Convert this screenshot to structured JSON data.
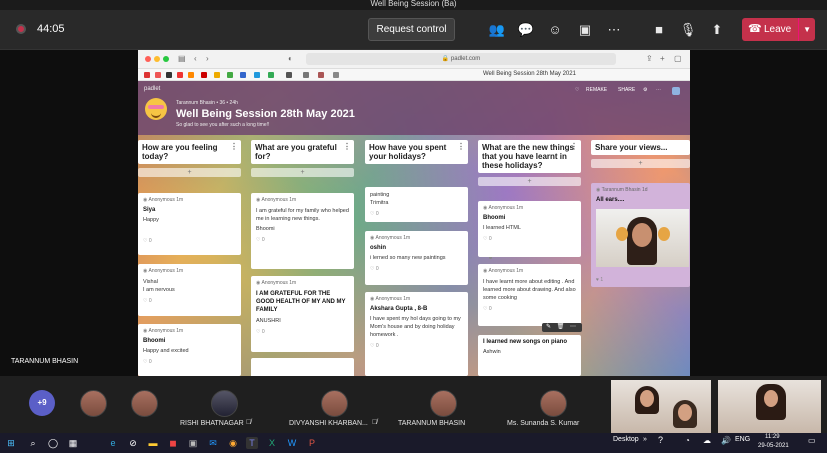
{
  "window": {
    "title": "Well Being Session (Ba)"
  },
  "meeting": {
    "timer": "44:05",
    "request_control": "Request control",
    "leave": "Leave",
    "icons": [
      "people-icon",
      "chat-icon",
      "reactions-icon",
      "rooms-icon",
      "more-icon",
      "camera-icon",
      "mic-icon",
      "share-icon"
    ],
    "accent": "#c4314b"
  },
  "presenter": {
    "name": "TARANNUM BHASIN"
  },
  "browser": {
    "url": "padlet.com",
    "tab_title": "Well Being Session 28th May 2021"
  },
  "padlet": {
    "brand": "padlet",
    "author": "Tarannum Bhasin",
    "author_meta": "• 36 • 24h",
    "title": "Well Being Session 28th May 2021",
    "subtitle": "So glad to see you after such a long time!!",
    "actions": {
      "remake": "REMAKE",
      "share": "SHARE"
    },
    "columns": [
      {
        "title": "How are you feeling today?"
      },
      {
        "title": "What are you grateful for?"
      },
      {
        "title": "How have you spent your holidays?"
      },
      {
        "title": "What are the new things that you have learnt in these holidays?"
      },
      {
        "title": "Share your views..."
      }
    ],
    "add_label": "+",
    "cards": {
      "c1_1": {
        "meta": "Anonymous 1m",
        "sub": "Siya",
        "body": "Happy",
        "like": "♡ 0"
      },
      "c1_2": {
        "meta": "Anonymous 1m",
        "sub": "",
        "body": "Vishal\nI am nervous",
        "like": "♡ 0"
      },
      "c1_3": {
        "meta": "Anonymous 1m",
        "sub": "Bhoomi",
        "body": "Happy and excited",
        "like": "♡ 0"
      },
      "c2_1": {
        "meta": "Anonymous 1m",
        "sub": "",
        "body": "I am grateful for my family who helped me in learning new things.",
        "body2": "Bhoomi",
        "like": "♡ 0"
      },
      "c2_2": {
        "meta": "Anonymous 1m",
        "sub": "I AM GRATEFUL FOR THE GOOD HEALTH OF MY AND MY FAMILY",
        "body": "ANUSHRI",
        "like": "♡ 0"
      },
      "c3_1": {
        "meta": "",
        "sub": "",
        "body": "painting\nTrimitra",
        "like": "♡ 0"
      },
      "c3_2": {
        "meta": "Anonymous 1m",
        "sub": "oshin",
        "body": "i lerned so many new paintings",
        "like": "♡ 0"
      },
      "c3_3": {
        "meta": "Anonymous 1m",
        "sub": "Akshara Gupta , 8-B",
        "body": "I have spent my hol days going to my Mom's house and by doing holiday homework .",
        "like": "♡ 0"
      },
      "c4_1": {
        "meta": "Anonymous 1m",
        "sub": "Bhoomi",
        "body": "I learned HTML",
        "like": "♡ 0"
      },
      "c4_2": {
        "meta": "Anonymous 1m",
        "sub": "",
        "body": "I have learnt more about editing . And learned more about drawing. And also some cooking",
        "like": "♡ 0"
      },
      "c4_3": {
        "meta": "",
        "sub": "I learned new songs on piano",
        "body": "Ashwin",
        "like": ""
      },
      "c5_1": {
        "meta": "Tarannum Bhasin 1d",
        "sub": "All ears....",
        "body": "",
        "like": "♥ 1"
      }
    }
  },
  "participants": {
    "more_count": "+9",
    "people": [
      {
        "name": ""
      },
      {
        "name": ""
      },
      {
        "name": "RISHI BHATNAGAR"
      },
      {
        "name": "DIVYANSHI KHARBAN..."
      },
      {
        "name": "TARANNUM BHASIN"
      },
      {
        "name": "Ms. Sunanda S. Kumar"
      }
    ]
  },
  "taskbar": {
    "desktop": "Desktop",
    "lang": "ENG",
    "time": "11:29",
    "date": "29-05-2021"
  }
}
